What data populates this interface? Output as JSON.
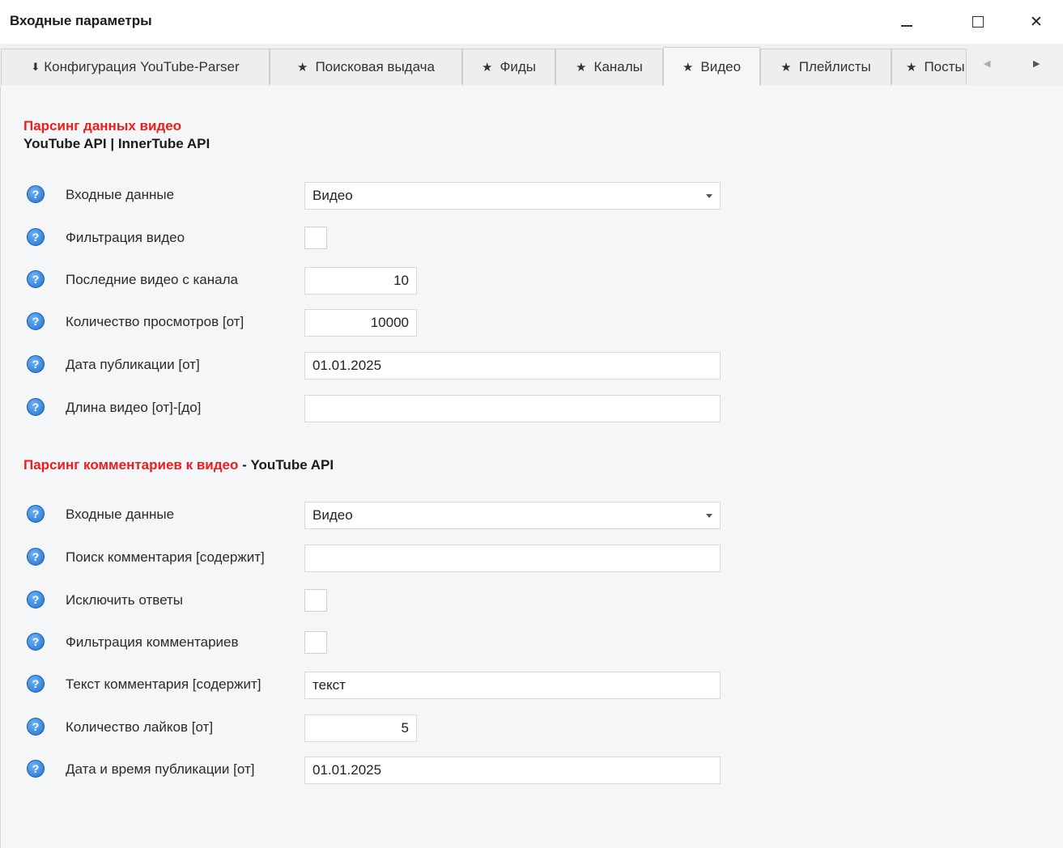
{
  "window": {
    "title": "Входные параметры",
    "minimize_glyph": "–",
    "close_glyph": "✕"
  },
  "tabs": [
    {
      "glyph": "⬇",
      "label": "Конфигурация YouTube-Parser"
    },
    {
      "glyph": "★",
      "label": "Поисковая выдача"
    },
    {
      "glyph": "★",
      "label": "Фиды"
    },
    {
      "glyph": "★",
      "label": "Каналы"
    },
    {
      "glyph": "★",
      "label": "Видео"
    },
    {
      "glyph": "★",
      "label": "Плейлисты"
    },
    {
      "glyph": "★",
      "label": "Посты"
    }
  ],
  "active_tab": "Видео",
  "tab_nav": {
    "left": "◀",
    "right": "▶"
  },
  "help_glyph": "?",
  "video_section": {
    "heading": "Парсинг данных видео",
    "subheading": "YouTube API | InnerTube API",
    "fields": {
      "input_data": {
        "label": "Входные данные",
        "value": "Видео"
      },
      "filter_video": {
        "label": "Фильтрация видео",
        "checked": false
      },
      "last_videos": {
        "label": "Последние видео с канала",
        "value": "10"
      },
      "views_from": {
        "label": "Количество просмотров [от]",
        "value": "10000"
      },
      "publish_date_from": {
        "label": "Дата публикации [от]",
        "value": "01.01.2025"
      },
      "video_length": {
        "label": "Длина видео [от]-[до]",
        "value": ""
      }
    }
  },
  "comments_section": {
    "heading_red": "Парсинг комментариев к видео",
    "heading_suffix": " - YouTube API",
    "fields": {
      "input_data": {
        "label": "Входные данные",
        "value": "Видео"
      },
      "search_comment": {
        "label": "Поиск комментария [содержит]",
        "value": ""
      },
      "exclude_replies": {
        "label": "Исключить ответы",
        "checked": false
      },
      "filter_comments": {
        "label": "Фильтрация комментариев",
        "checked": false
      },
      "comment_text": {
        "label": "Текст комментария [содержит]",
        "value": "текст"
      },
      "likes_from": {
        "label": "Количество лайков [от]",
        "value": "5"
      },
      "publish_datetime_from": {
        "label": "Дата и время публикации [от]",
        "value": "01.01.2025"
      }
    }
  },
  "colors": {
    "heading_red": "#ee1c1c",
    "help_icon": "#1f6fcf",
    "content_bg": "#f5f6f8"
  }
}
